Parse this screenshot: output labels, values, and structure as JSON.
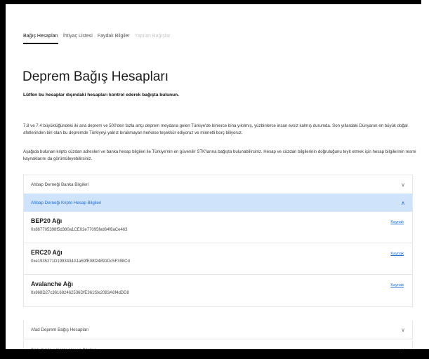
{
  "tabs": [
    {
      "label": "Bağış Hesapları"
    },
    {
      "label": "İhtiyaç Listesi"
    },
    {
      "label": "Faydalı Bilgiler"
    },
    {
      "label": "Yapılan Bağışlar"
    }
  ],
  "page": {
    "title": "Deprem Bağış Hesapları",
    "subtitle": "Lütfen bu hesaplar dışındaki hesapları kontrol ederek bağışta bulunun.",
    "paragraph1": "7.8 ve 7.4 büyüklüğündeki iki ana deprem ve 500'den fazla artçı deprem meydana gelen Türkiye'de binlerce bina yıkılmış, yüzbinlerce insan evsiz kalmış durumda. Son yıllardaki Dünyanın en büyük doğal afetlerinden biri olan bu depremde Türkiyeyi yalnız bırakmayan herkese teşekkür ediyoruz ve minnetli borç biliyoruz.",
    "paragraph2": "Aşağıda bulunan kripto cüzdan adresleri ve banka hesap bilgileri ile Türkiye'nin en güvenilir STK'larına bağışta bulunabilirsiniz. Hesap ve cüzdan bilgilerinin doğruluğunu teyit etmek için hesap bilgilerinin resmi kaynaklarını da görüntüleyebilirsiniz."
  },
  "accordions": {
    "ahbap_bank": {
      "label": "Ahbap Derneği Banka Bilgileri",
      "icon": "chevron-down-icon"
    },
    "ahbap_crypto": {
      "label": "Ahbap Derneği Kripto Hesap Bilgileri",
      "icon": "chevron-up-icon",
      "networks": [
        {
          "name": "BEP20 Ağı",
          "address": "0x867705398f5d380a1CE02e77095fed64f8aCe463",
          "link": "Kaynak"
        },
        {
          "name": "ERC20 Ağı",
          "address": "0xe1935271D1993434A1a59fE08f24891Dc5F398Cd",
          "link": "Kaynak"
        },
        {
          "name": "Avalanche Ağı",
          "address": "0x868D27c361682462536DfE361f2e2083A6f4dDD8",
          "link": "Kaynak"
        }
      ]
    },
    "afad": {
      "label": "Afad Deprem Bağış Hesapları",
      "icon": "chevron-down-icon"
    },
    "kizilay": {
      "label": "Türk Kızılayı Kripto Hesap Bilgileri",
      "icon": "chevron-down-icon"
    }
  },
  "colors": {
    "accent": "#1f6fd6",
    "expanded_bg": "#cfe3fb"
  }
}
